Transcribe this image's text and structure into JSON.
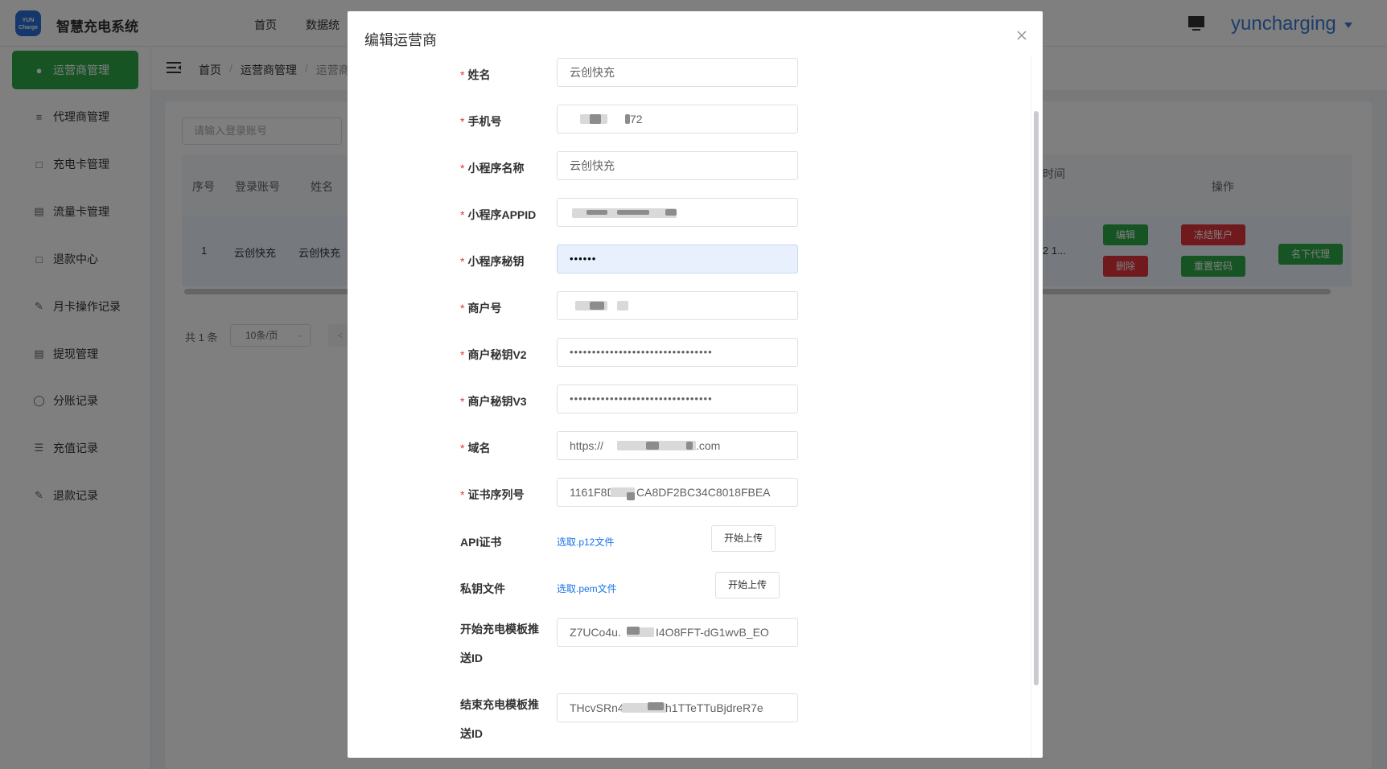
{
  "header": {
    "logo_text": "YUN Charge",
    "app_title": "智慧充电系统",
    "nav": [
      "首页",
      "数据统"
    ],
    "user": "yuncharging"
  },
  "sidebar": {
    "items": [
      {
        "label": "运营商管理",
        "icon": "user-icon",
        "active": true
      },
      {
        "label": "代理商管理",
        "icon": "sliders-icon"
      },
      {
        "label": "充电卡管理",
        "icon": "folder-icon"
      },
      {
        "label": "流量卡管理",
        "icon": "card-icon"
      },
      {
        "label": "退款中心",
        "icon": "folder-icon"
      },
      {
        "label": "月卡操作记录",
        "icon": "edit-icon"
      },
      {
        "label": "提现管理",
        "icon": "document-icon"
      },
      {
        "label": "分账记录",
        "icon": "database-icon"
      },
      {
        "label": "充值记录",
        "icon": "list-icon"
      },
      {
        "label": "退款记录",
        "icon": "edit-icon"
      }
    ]
  },
  "breadcrumb": [
    "首页",
    "运营商管理",
    "运营商"
  ],
  "search": {
    "placeholder": "请输入登录账号"
  },
  "table": {
    "headers": {
      "index": "序号",
      "account": "登录账号",
      "name": "姓名",
      "time": "时间",
      "ops": "操作"
    },
    "row": {
      "index": "1",
      "account": "云创快充",
      "name": "云创快充",
      "time": "2 1..."
    },
    "buttons": {
      "edit": "编辑",
      "delete": "删除",
      "freeze": "冻结账户",
      "reset": "重置密码",
      "agent": "名下代理"
    }
  },
  "pagination": {
    "total": "共 1 条",
    "page_size": "10条/页"
  },
  "dialog": {
    "title": "编辑运营商",
    "fields": {
      "name": {
        "label": "姓名",
        "value": "云创快充"
      },
      "phone": {
        "label": "手机号",
        "value": "72"
      },
      "mp_name": {
        "label": "小程序名称",
        "value": "云创快充"
      },
      "appid": {
        "label": "小程序APPID",
        "value": ""
      },
      "mp_secret": {
        "label": "小程序秘钥",
        "value": "••••••"
      },
      "merchant": {
        "label": "商户号",
        "value": ""
      },
      "key_v2": {
        "label": "商户秘钥V2",
        "value": "••••••••••••••••••••••••••••••••"
      },
      "key_v3": {
        "label": "商户秘钥V3",
        "value": "••••••••••••••••••••••••••••••••"
      },
      "domain": {
        "label": "域名",
        "value_prefix": "https://",
        "value_suffix": ".com"
      },
      "cert_serial": {
        "label": "证书序列号",
        "value_prefix": "1161F8D",
        "value_suffix": "CA8DF2BC34C8018FBEA"
      },
      "start_tpl": {
        "label": "开始充电模板推送ID",
        "value_prefix": "Z7UCo4u.",
        "value_suffix": "I4O8FFT-dG1wvB_EO"
      },
      "end_tpl": {
        "label": "结束充电模板推送ID",
        "value_prefix": "THcvSRn4",
        "value_suffix": "h1TTeTTuBjdreR7e"
      }
    },
    "api_cert": {
      "label": "API证书",
      "link": "选取.p12文件",
      "button": "开始上传"
    },
    "private_key": {
      "label": "私钥文件",
      "link": "选取.pem文件",
      "button": "开始上传"
    }
  }
}
